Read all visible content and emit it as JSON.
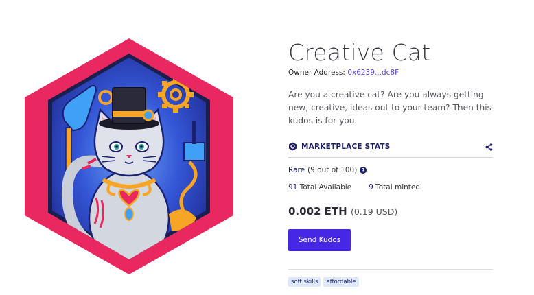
{
  "kudos": {
    "title": "Creative Cat",
    "owner_label": "Owner Address:",
    "owner_address": "0x6239...dc8F",
    "description": "Are you a creative cat? Are you always getting new, creative, ideas out to your team? Then this kudos is for you."
  },
  "stats": {
    "header": "MARKETPLACE STATS",
    "rarity_word": "Rare",
    "rarity_detail": "(9 out of 100)",
    "help_glyph": "?",
    "available_count": "91",
    "available_label": "Total Available",
    "minted_count": "9",
    "minted_label": "Total minted"
  },
  "price": {
    "eth": "0.002 ETH",
    "usd": "(0.19 USD)"
  },
  "actions": {
    "send_label": "Send Kudos"
  },
  "tags": [
    "soft skills",
    "affordable"
  ],
  "colors": {
    "accent": "#4727e6",
    "navy": "#1e1e6e",
    "hex_border": "#e8285e",
    "art_bg": "#2f47c4"
  },
  "icons": {
    "stats": "gitcoin-logo-icon",
    "share": "share-icon",
    "help": "question-circle-icon"
  }
}
